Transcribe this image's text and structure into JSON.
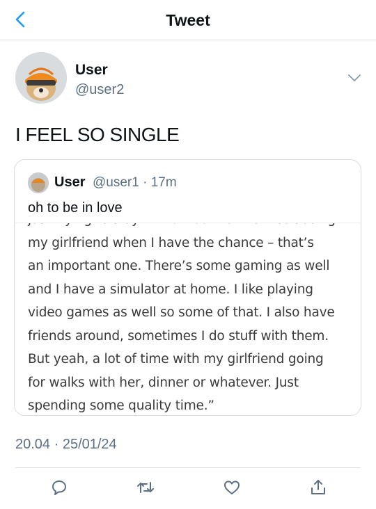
{
  "nav": {
    "title": "Tweet",
    "back_icon": "chevron-left-icon"
  },
  "tweet": {
    "author_name": "User",
    "author_handle": "@user2",
    "text": "I FEEL SO SINGLE",
    "timestamp": "20.04 · 25/01/24"
  },
  "quote": {
    "author_name": "User",
    "meta": "@user1 · 17m",
    "text": "oh to be in love",
    "image_lines": [
      "just trying to stay in that routine. It’s nice seeing",
      "my girlfriend when I have the chance – that’s",
      "an important one. There’s some gaming as well",
      "and I have a simulator at home. I like playing",
      "video games as well so some of that. I also have",
      "friends around, sometimes I do stuff with them.",
      "But yeah, a lot of time with my girlfriend going",
      "for walks with her, dinner or whatever. Just",
      "spending some quality time.”"
    ]
  },
  "actions": [
    "reply-icon",
    "retweet-icon",
    "like-icon",
    "share-icon"
  ],
  "colors": {
    "accent": "#1d9bf0",
    "secondary_text": "#5b7083",
    "border": "#e1e4e6"
  }
}
